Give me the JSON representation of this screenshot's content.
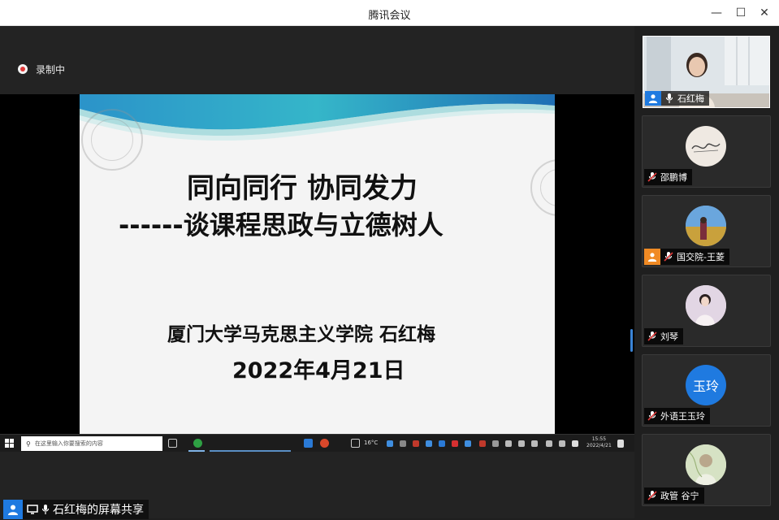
{
  "window": {
    "title": "腾讯会议"
  },
  "recording": {
    "label": "录制中"
  },
  "slide": {
    "title_line1": "同向同行 协同发力",
    "title_line2": "------谈课程思政与立德树人",
    "author": "厦门大学马克思主义学院 石红梅",
    "date": "2022年4月21日"
  },
  "taskbar": {
    "search_placeholder": "在这里输入你要搜索的内容",
    "weather": "16°C",
    "time": "15:55",
    "date": "2022/4/21"
  },
  "share_bar": {
    "label": "石红梅的屏幕共享"
  },
  "participants": [
    {
      "name": "石红梅",
      "type": "video"
    },
    {
      "name": "邵鹏博",
      "type": "avatar"
    },
    {
      "name": "国交院-王菱",
      "type": "avatar"
    },
    {
      "name": "刘琴",
      "type": "avatar"
    },
    {
      "name": "外语王玉玲",
      "type": "initials",
      "initials": "玉玲"
    },
    {
      "name": "政管 谷宁",
      "type": "avatar"
    }
  ],
  "colors": {
    "accent": "#1f7ae0",
    "mute_red": "#e03a3a",
    "orange_badge": "#f08a24"
  }
}
